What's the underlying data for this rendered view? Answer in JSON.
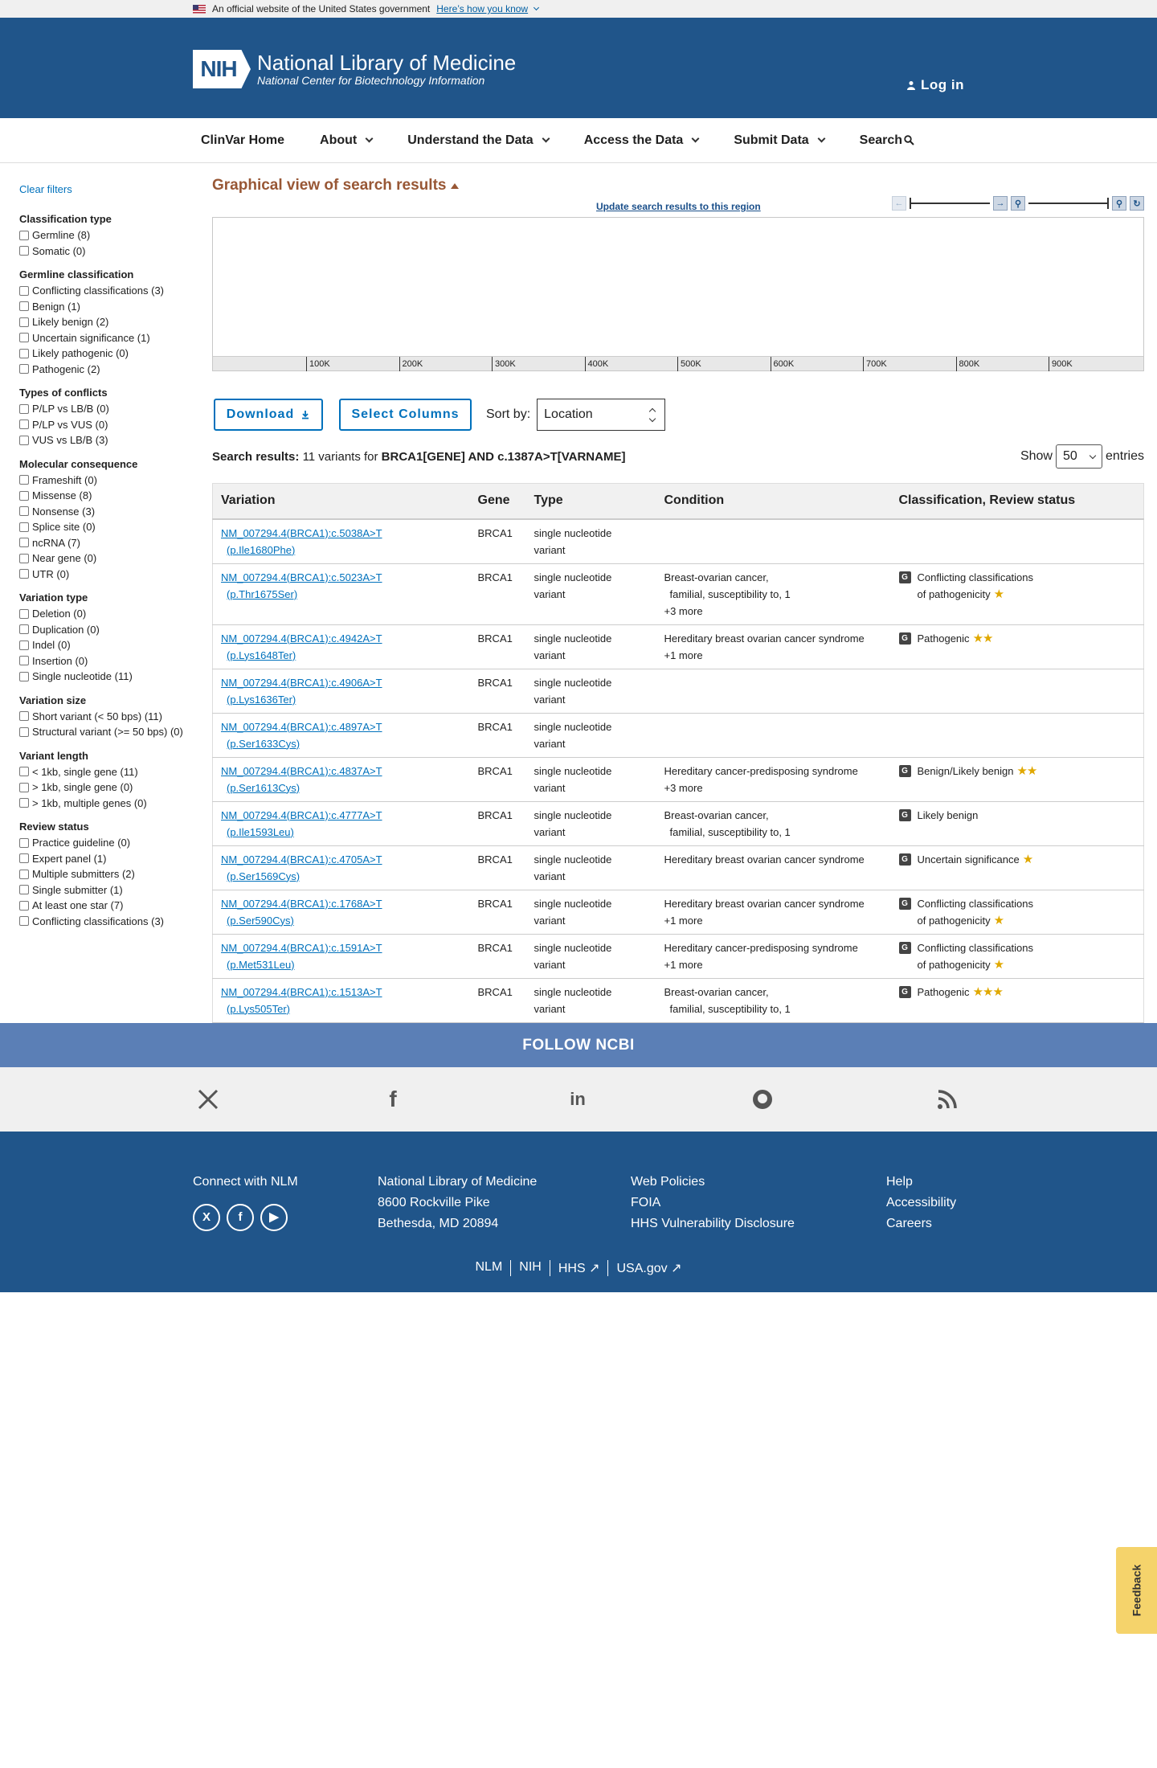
{
  "gov_banner": {
    "text": "An official website of the United States government",
    "link": "Here’s how you know"
  },
  "header": {
    "nih": "NIH",
    "title": "National Library of Medicine",
    "subtitle": "National Center for Biotechnology Information",
    "login": "Log in"
  },
  "nav": {
    "items": [
      "ClinVar Home",
      "About",
      "Understand the Data",
      "Access the Data",
      "Submit Data",
      "Search"
    ]
  },
  "sidebar": {
    "clear": "Clear filters",
    "groups": [
      {
        "title": "Classification type",
        "options": [
          "Germline (8)",
          "Somatic (0)"
        ]
      },
      {
        "title": "Germline classification",
        "options": [
          "Conflicting classifications (3)",
          "Benign (1)",
          "Likely benign (2)",
          "Uncertain significance (1)",
          "Likely pathogenic (0)",
          "Pathogenic (2)"
        ]
      },
      {
        "title": "Types of conflicts",
        "options": [
          "P/LP vs LB/B (0)",
          "P/LP vs VUS (0)",
          "VUS vs LB/B (3)"
        ]
      },
      {
        "title": "Molecular consequence",
        "options": [
          "Frameshift (0)",
          "Missense (8)",
          "Nonsense (3)",
          "Splice site (0)",
          "ncRNA (7)",
          "Near gene (0)",
          "UTR (0)"
        ]
      },
      {
        "title": "Variation type",
        "options": [
          "Deletion (0)",
          "Duplication (0)",
          "Indel (0)",
          "Insertion (0)",
          "Single nucleotide (11)"
        ]
      },
      {
        "title": "Variation size",
        "options": [
          "Short variant (< 50 bps) (11)",
          "Structural variant (>= 50 bps) (0)"
        ]
      },
      {
        "title": "Variant length",
        "options": [
          "< 1kb, single gene (11)",
          "> 1kb, single gene (0)",
          "> 1kb, multiple genes (0)"
        ]
      },
      {
        "title": "Review status",
        "options": [
          "Practice guideline (0)",
          "Expert panel (1)",
          "Multiple submitters (2)",
          "Single submitter (1)",
          "At least one star (7)",
          "Conflicting classifications (3)"
        ]
      }
    ]
  },
  "graphical": {
    "title": "Graphical view of search results",
    "update": "Update search results to this region",
    "ticks": [
      "100K",
      "200K",
      "300K",
      "400K",
      "500K",
      "600K",
      "700K",
      "800K",
      "900K"
    ]
  },
  "toolbar": {
    "download": "Download",
    "select_columns": "Select Columns",
    "sort_label": "Sort by:",
    "sort_value": "Location"
  },
  "results": {
    "prefix": "Search results:",
    "count_text": "11 variants for",
    "query": "BRCA1[GENE] AND c.1387A>T[VARNAME]",
    "show": "Show",
    "show_value": "50",
    "entries": "entries"
  },
  "table": {
    "headers": [
      "Variation",
      "Gene",
      "Type",
      "Condition",
      "Classification, Review status"
    ],
    "rows": [
      {
        "v1": "NM_007294.4(BRCA1):c.5038A>T",
        "v2": "(p.Ile1680Phe)",
        "gene": "BRCA1",
        "t1": "single nucleotide",
        "t2": "variant",
        "c1": "",
        "c2": "",
        "c3": "",
        "badge": "",
        "cls1": "",
        "cls2": "",
        "stars": ""
      },
      {
        "v1": "NM_007294.4(BRCA1):c.5023A>T",
        "v2": "(p.Thr1675Ser)",
        "gene": "BRCA1",
        "t1": "single nucleotide",
        "t2": "variant",
        "c1": "Breast-ovarian cancer,",
        "c2": "familial, susceptibility to, 1",
        "c3": "+3 more",
        "badge": "G",
        "cls1": "Conflicting classifications",
        "cls2": "of pathogenicity",
        "stars": "★"
      },
      {
        "v1": "NM_007294.4(BRCA1):c.4942A>T",
        "v2": "(p.Lys1648Ter)",
        "gene": "BRCA1",
        "t1": "single nucleotide",
        "t2": "variant",
        "c1": "Hereditary breast ovarian cancer syndrome",
        "c2": "",
        "c3": "+1 more",
        "badge": "G",
        "cls1": "Pathogenic",
        "cls2": "",
        "stars": "★★"
      },
      {
        "v1": "NM_007294.4(BRCA1):c.4906A>T",
        "v2": "(p.Lys1636Ter)",
        "gene": "BRCA1",
        "t1": "single nucleotide",
        "t2": "variant",
        "c1": "",
        "c2": "",
        "c3": "",
        "badge": "",
        "cls1": "",
        "cls2": "",
        "stars": ""
      },
      {
        "v1": "NM_007294.4(BRCA1):c.4897A>T",
        "v2": "(p.Ser1633Cys)",
        "gene": "BRCA1",
        "t1": "single nucleotide",
        "t2": "variant",
        "c1": "",
        "c2": "",
        "c3": "",
        "badge": "",
        "cls1": "",
        "cls2": "",
        "stars": ""
      },
      {
        "v1": "NM_007294.4(BRCA1):c.4837A>T",
        "v2": "(p.Ser1613Cys)",
        "gene": "BRCA1",
        "t1": "single nucleotide",
        "t2": "variant",
        "c1": "Hereditary cancer-predisposing syndrome",
        "c2": "",
        "c3": "+3 more",
        "badge": "G",
        "cls1": "Benign/Likely benign",
        "cls2": "",
        "stars": "★★"
      },
      {
        "v1": "NM_007294.4(BRCA1):c.4777A>T",
        "v2": "(p.Ile1593Leu)",
        "gene": "BRCA1",
        "t1": "single nucleotide",
        "t2": "variant",
        "c1": "Breast-ovarian cancer,",
        "c2": "familial, susceptibility to, 1",
        "c3": "",
        "badge": "G",
        "cls1": "Likely benign",
        "cls2": "",
        "stars": ""
      },
      {
        "v1": "NM_007294.4(BRCA1):c.4705A>T",
        "v2": "(p.Ser1569Cys)",
        "gene": "BRCA1",
        "t1": "single nucleotide",
        "t2": "variant",
        "c1": "Hereditary breast ovarian cancer syndrome",
        "c2": "",
        "c3": "",
        "badge": "G",
        "cls1": "Uncertain significance",
        "cls2": "",
        "stars": "★"
      },
      {
        "v1": "NM_007294.4(BRCA1):c.1768A>T",
        "v2": "(p.Ser590Cys)",
        "gene": "BRCA1",
        "t1": "single nucleotide",
        "t2": "variant",
        "c1": "Hereditary breast ovarian cancer syndrome",
        "c2": "",
        "c3": "+1 more",
        "badge": "G",
        "cls1": "Conflicting classifications",
        "cls2": "of pathogenicity",
        "stars": "★"
      },
      {
        "v1": "NM_007294.4(BRCA1):c.1591A>T",
        "v2": "(p.Met531Leu)",
        "gene": "BRCA1",
        "t1": "single nucleotide",
        "t2": "variant",
        "c1": "Hereditary cancer-predisposing syndrome",
        "c2": "",
        "c3": "+1 more",
        "badge": "G",
        "cls1": "Conflicting classifications",
        "cls2": "of pathogenicity",
        "stars": "★"
      },
      {
        "v1": "NM_007294.4(BRCA1):c.1513A>T",
        "v2": "(p.Lys505Ter)",
        "gene": "BRCA1",
        "t1": "single nucleotide",
        "t2": "variant",
        "c1": "Breast-ovarian cancer,",
        "c2": "familial, susceptibility to, 1",
        "c3": "",
        "badge": "G",
        "cls1": "Pathogenic",
        "cls2": "",
        "stars": "★★★"
      }
    ]
  },
  "footer": {
    "follow": "FOLLOW NCBI",
    "social_icons": [
      "x-icon",
      "facebook-icon",
      "linkedin-icon",
      "github-icon",
      "rss-icon"
    ],
    "connect": "Connect with NLM",
    "address": [
      "National Library of Medicine",
      "8600 Rockville Pike",
      "Bethesda, MD 20894"
    ],
    "policies": [
      "Web Policies",
      "FOIA",
      "HHS Vulnerability Disclosure"
    ],
    "help": [
      "Help",
      "Accessibility",
      "Careers"
    ],
    "bottom": [
      "NLM",
      "NIH",
      "HHS",
      "USA.gov"
    ]
  },
  "feedback": "Feedback"
}
